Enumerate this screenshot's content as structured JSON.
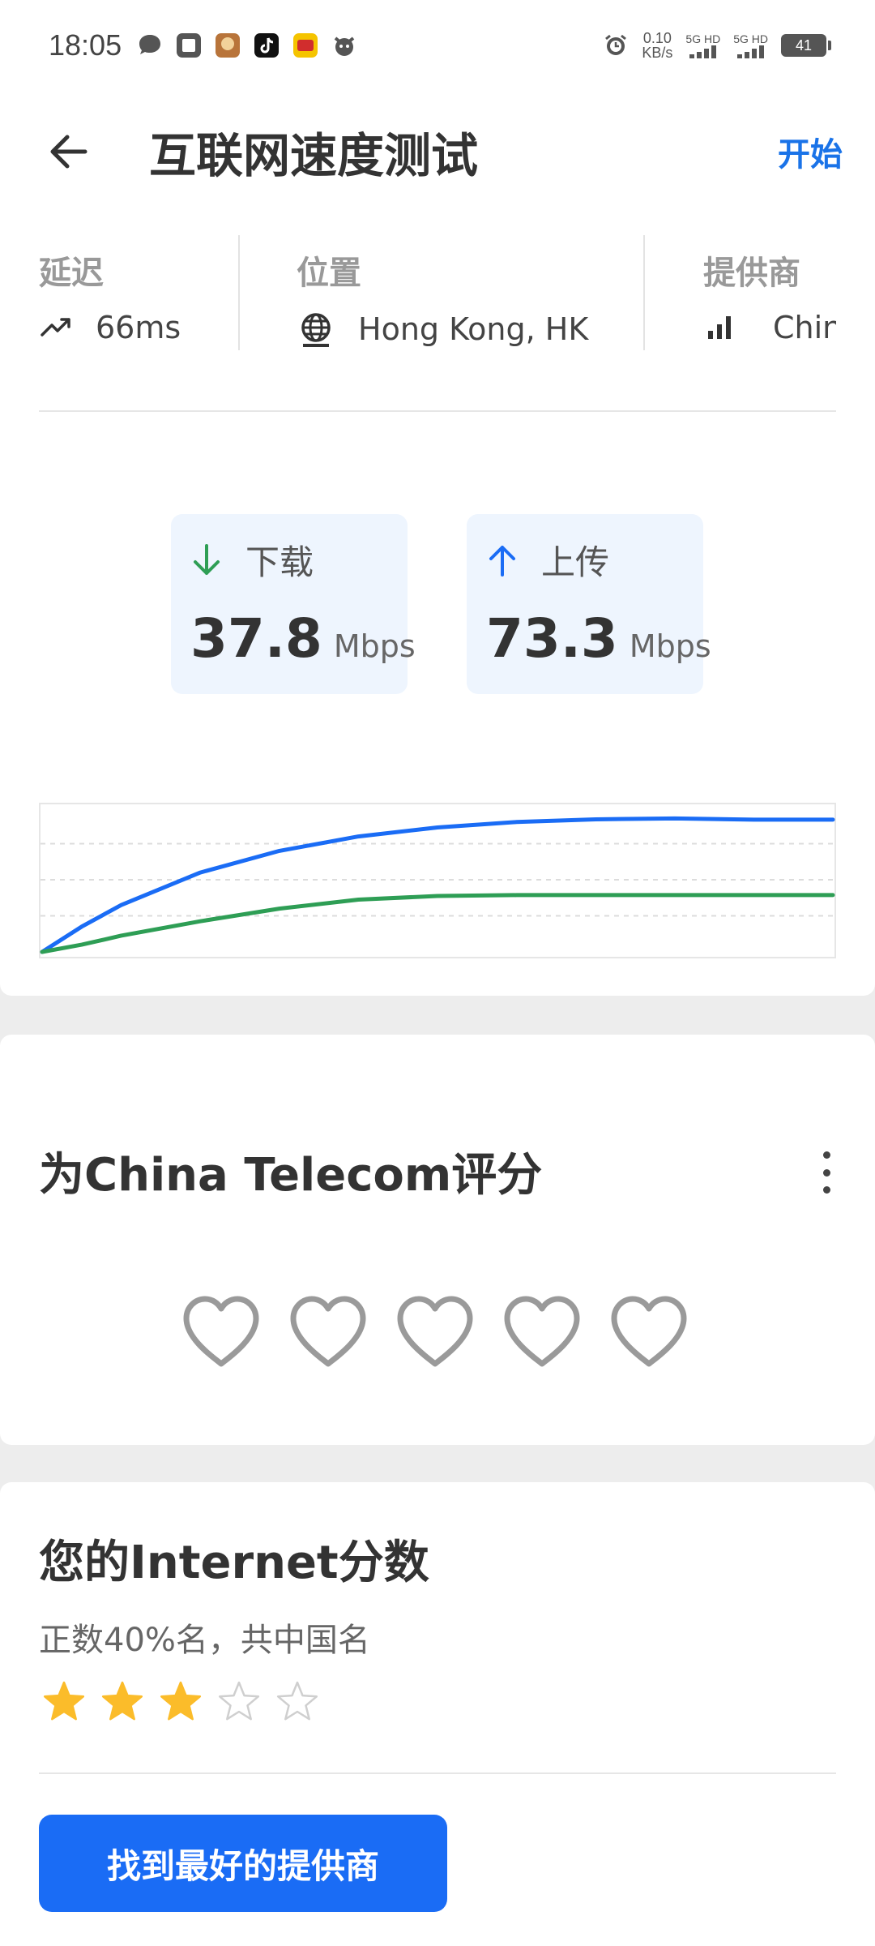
{
  "status_bar": {
    "time": "18:05",
    "net_speed_value": "0.10",
    "net_speed_unit": "KB/s",
    "sim1_label": "5G HD",
    "sim2_label": "5G HD",
    "battery": "41",
    "icons": [
      "chat-icon",
      "pay-app-icon",
      "game-app-icon",
      "tiktok-icon",
      "video-app-icon",
      "mascot-app-icon",
      "alarm-icon"
    ]
  },
  "app_bar": {
    "title": "互联网速度测试",
    "start_label": "开始"
  },
  "info": {
    "latency_label": "延迟",
    "latency_value": "66ms",
    "location_label": "位置",
    "location_value": "Hong Kong, HK",
    "provider_label": "提供商",
    "provider_value": "China Telecom"
  },
  "speed": {
    "download_label": "下载",
    "download_value": "37.8",
    "upload_label": "上传",
    "upload_value": "73.3",
    "unit": "Mbps"
  },
  "chart_data": {
    "type": "line",
    "x": [
      0,
      0.05,
      0.1,
      0.2,
      0.3,
      0.4,
      0.5,
      0.6,
      0.7,
      0.8,
      0.9,
      1.0
    ],
    "series": [
      {
        "values": [
          0,
          14,
          26,
          44,
          56,
          64,
          69,
          72,
          73.5,
          74,
          73.3,
          73.3
        ],
        "color": "#1a6cf5"
      },
      {
        "values": [
          0,
          4,
          9,
          17,
          24,
          29,
          31,
          31.5,
          31.5,
          31.5,
          31.5,
          31.5
        ],
        "color": "#2e9e55"
      }
    ],
    "ylim": [
      0,
      80
    ],
    "grid": true
  },
  "rating": {
    "title": "为China Telecom评分",
    "hearts_total": 5,
    "hearts_filled": 0
  },
  "score": {
    "title": "您的Internet分数",
    "subtitle": "正数40%名，共中国名",
    "stars_filled": 3,
    "stars_total": 5,
    "button_label": "找到最好的提供商"
  },
  "colors": {
    "accent": "#1a6cf5",
    "download": "#2e9e55",
    "star": "#fbbc2a"
  }
}
